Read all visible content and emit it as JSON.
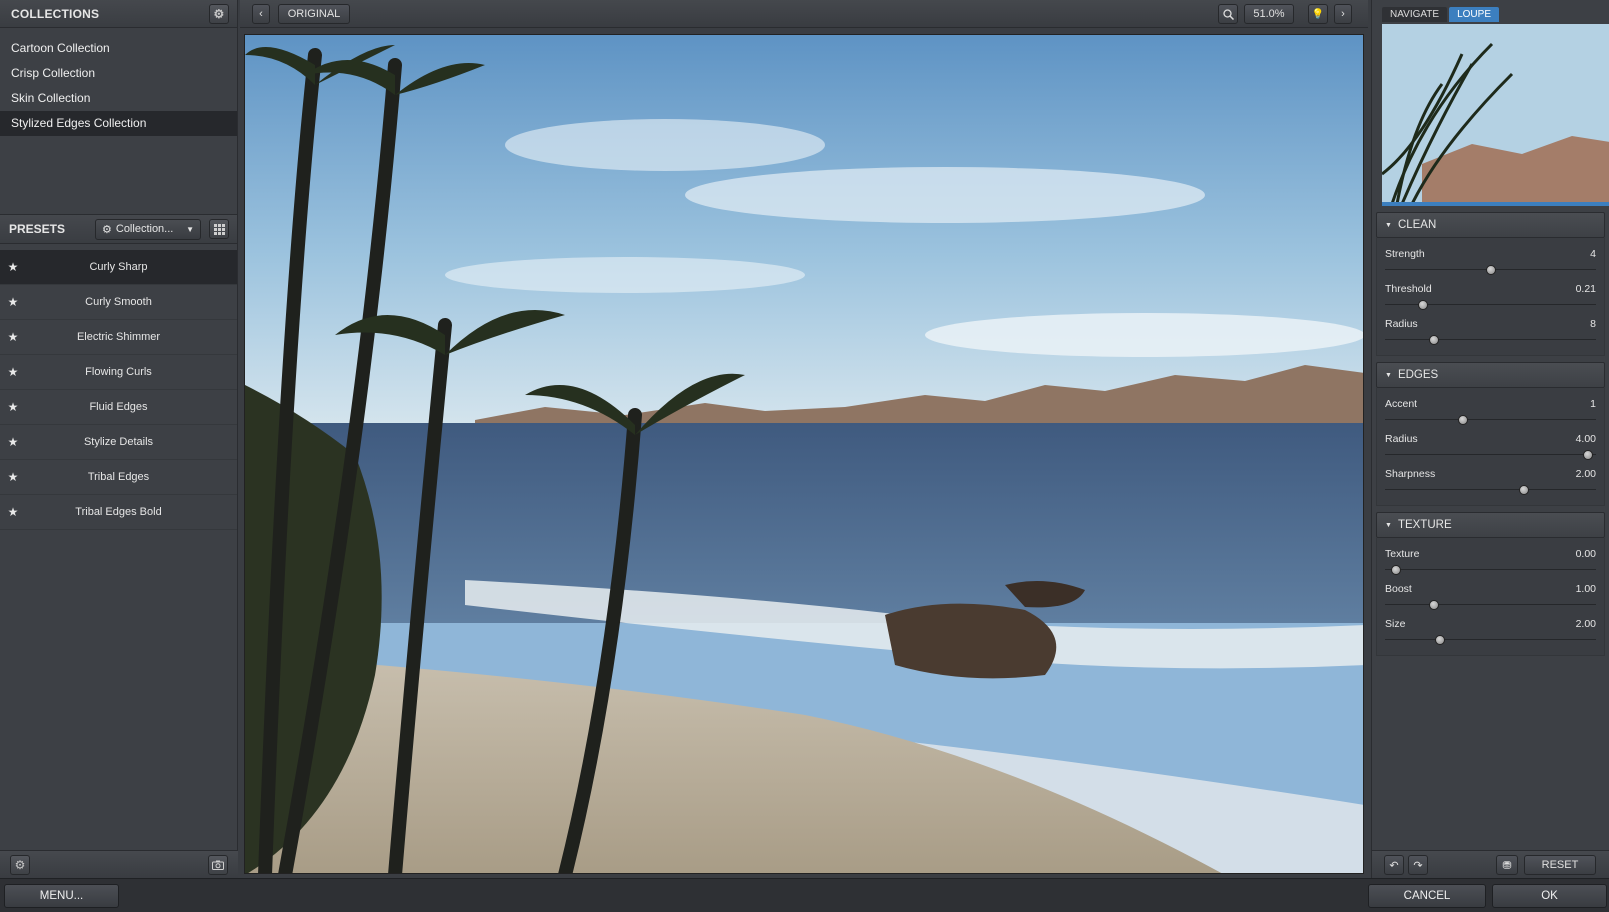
{
  "collections": {
    "title": "COLLECTIONS",
    "items": [
      {
        "label": "Cartoon Collection"
      },
      {
        "label": "Crisp Collection"
      },
      {
        "label": "Skin Collection"
      },
      {
        "label": "Stylized Edges Collection",
        "selected": true
      }
    ]
  },
  "presets": {
    "title": "PRESETS",
    "dropdown_label": "Collection...",
    "items": [
      {
        "label": "Curly Sharp",
        "selected": true
      },
      {
        "label": "Curly Smooth"
      },
      {
        "label": "Electric Shimmer"
      },
      {
        "label": "Flowing Curls"
      },
      {
        "label": "Fluid Edges"
      },
      {
        "label": "Stylize Details"
      },
      {
        "label": "Tribal Edges"
      },
      {
        "label": "Tribal Edges Bold"
      }
    ]
  },
  "toolbar": {
    "original_label": "ORIGINAL",
    "zoom": "51.0%"
  },
  "navigator": {
    "tab_navigate": "NAVIGATE",
    "tab_loupe": "LOUPE",
    "active_tab": "LOUPE"
  },
  "sections": [
    {
      "title": "CLEAN",
      "sliders": [
        {
          "label": "Strength",
          "value": "4",
          "fraction": 0.5
        },
        {
          "label": "Threshold",
          "value": "0.21",
          "fraction": 0.18
        },
        {
          "label": "Radius",
          "value": "8",
          "fraction": 0.23
        }
      ]
    },
    {
      "title": "EDGES",
      "sliders": [
        {
          "label": "Accent",
          "value": "1",
          "fraction": 0.37
        },
        {
          "label": "Radius",
          "value": "4.00",
          "fraction": 0.96
        },
        {
          "label": "Sharpness",
          "value": "2.00",
          "fraction": 0.66
        }
      ]
    },
    {
      "title": "TEXTURE",
      "sliders": [
        {
          "label": "Texture",
          "value": "0.00",
          "fraction": 0.05
        },
        {
          "label": "Boost",
          "value": "1.00",
          "fraction": 0.23
        },
        {
          "label": "Size",
          "value": "2.00",
          "fraction": 0.26
        }
      ]
    }
  ],
  "footer": {
    "menu_label": "MENU...",
    "reset_label": "RESET",
    "cancel_label": "CANCEL",
    "ok_label": "OK"
  },
  "icons": {
    "gear": "gear-icon",
    "grid": "grid-icon",
    "star": "star-icon",
    "camera": "camera-icon",
    "search": "search-icon",
    "bulb": "lightbulb-icon",
    "undo": "undo-icon",
    "redo": "redo-icon"
  },
  "colors": {
    "accent": "#3c7fbf",
    "panel": "#3d4045",
    "selected_row": "#26282c"
  }
}
